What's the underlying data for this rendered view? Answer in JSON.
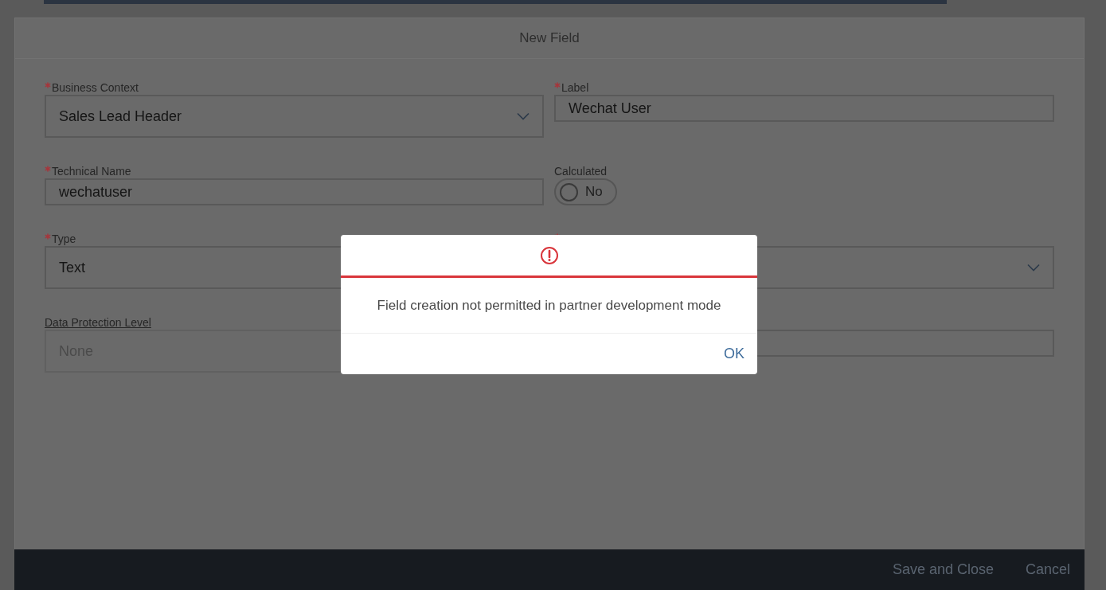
{
  "dialog": {
    "title": "New Field"
  },
  "fields": [
    {
      "kind": "select",
      "label": "Business Context",
      "required": true,
      "value": "Sales Lead Header"
    },
    {
      "kind": "input",
      "label": "Label",
      "required": true,
      "value": "Wechat User"
    },
    {
      "kind": "input",
      "label": "Technical Name",
      "required": true,
      "value": "wechatuser"
    },
    {
      "kind": "toggle",
      "label": "Calculated",
      "required": false,
      "on": false,
      "value": "No"
    },
    {
      "kind": "select",
      "label": "Type",
      "required": true,
      "value": "Text"
    },
    {
      "kind": "select",
      "required": true
    },
    {
      "kind": "disabled",
      "label": "Data Protection Level",
      "required": false,
      "label_link": true,
      "value": "None"
    },
    {
      "kind": "input",
      "required": false
    }
  ],
  "footer": {
    "buttons": [
      "Save and Close",
      "Cancel"
    ]
  },
  "message": {
    "text": "Field creation not permitted in partner development mode",
    "button": "OK"
  }
}
